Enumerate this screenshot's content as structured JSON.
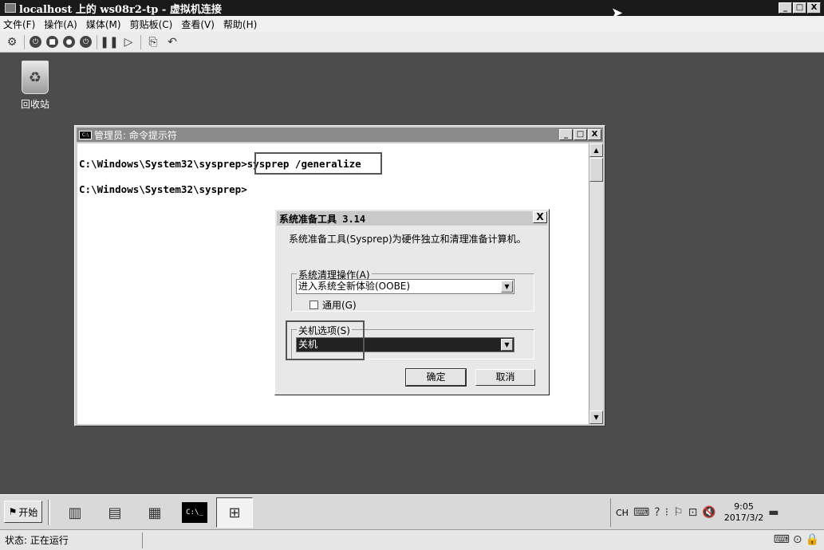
{
  "host": {
    "title": "localhost 上的 ws08r2-tp - 虚拟机连接",
    "menu": [
      "文件(F)",
      "操作(A)",
      "媒体(M)",
      "剪贴板(C)",
      "查看(V)",
      "帮助(H)"
    ],
    "window_buttons": [
      "_",
      "□",
      "X"
    ]
  },
  "desktop": {
    "recycle_label": "回收站"
  },
  "cmd": {
    "title": "管理员: 命令提示符",
    "line1_prompt": "C:\\Windows\\System32\\sysprep>",
    "line1_command": "sysprep /generalize",
    "line2_prompt": "C:\\Windows\\System32\\sysprep>"
  },
  "sysprep": {
    "title": "系统准备工具 3.14",
    "close": "X",
    "description": "系统准备工具(Sysprep)为硬件独立和清理准备计算机。",
    "cleanup_group": "系统清理操作(A)",
    "cleanup_value": "进入系统全新体验(OOBE)",
    "generalize_label": "通用(G)",
    "shutdown_group": "关机选项(S)",
    "shutdown_value": "关机",
    "ok": "确定",
    "cancel": "取消"
  },
  "taskbar": {
    "start": "开始",
    "lang": "CH",
    "time": "9:05",
    "date": "2017/3/2"
  },
  "status": {
    "label": "状态: 正在运行"
  }
}
